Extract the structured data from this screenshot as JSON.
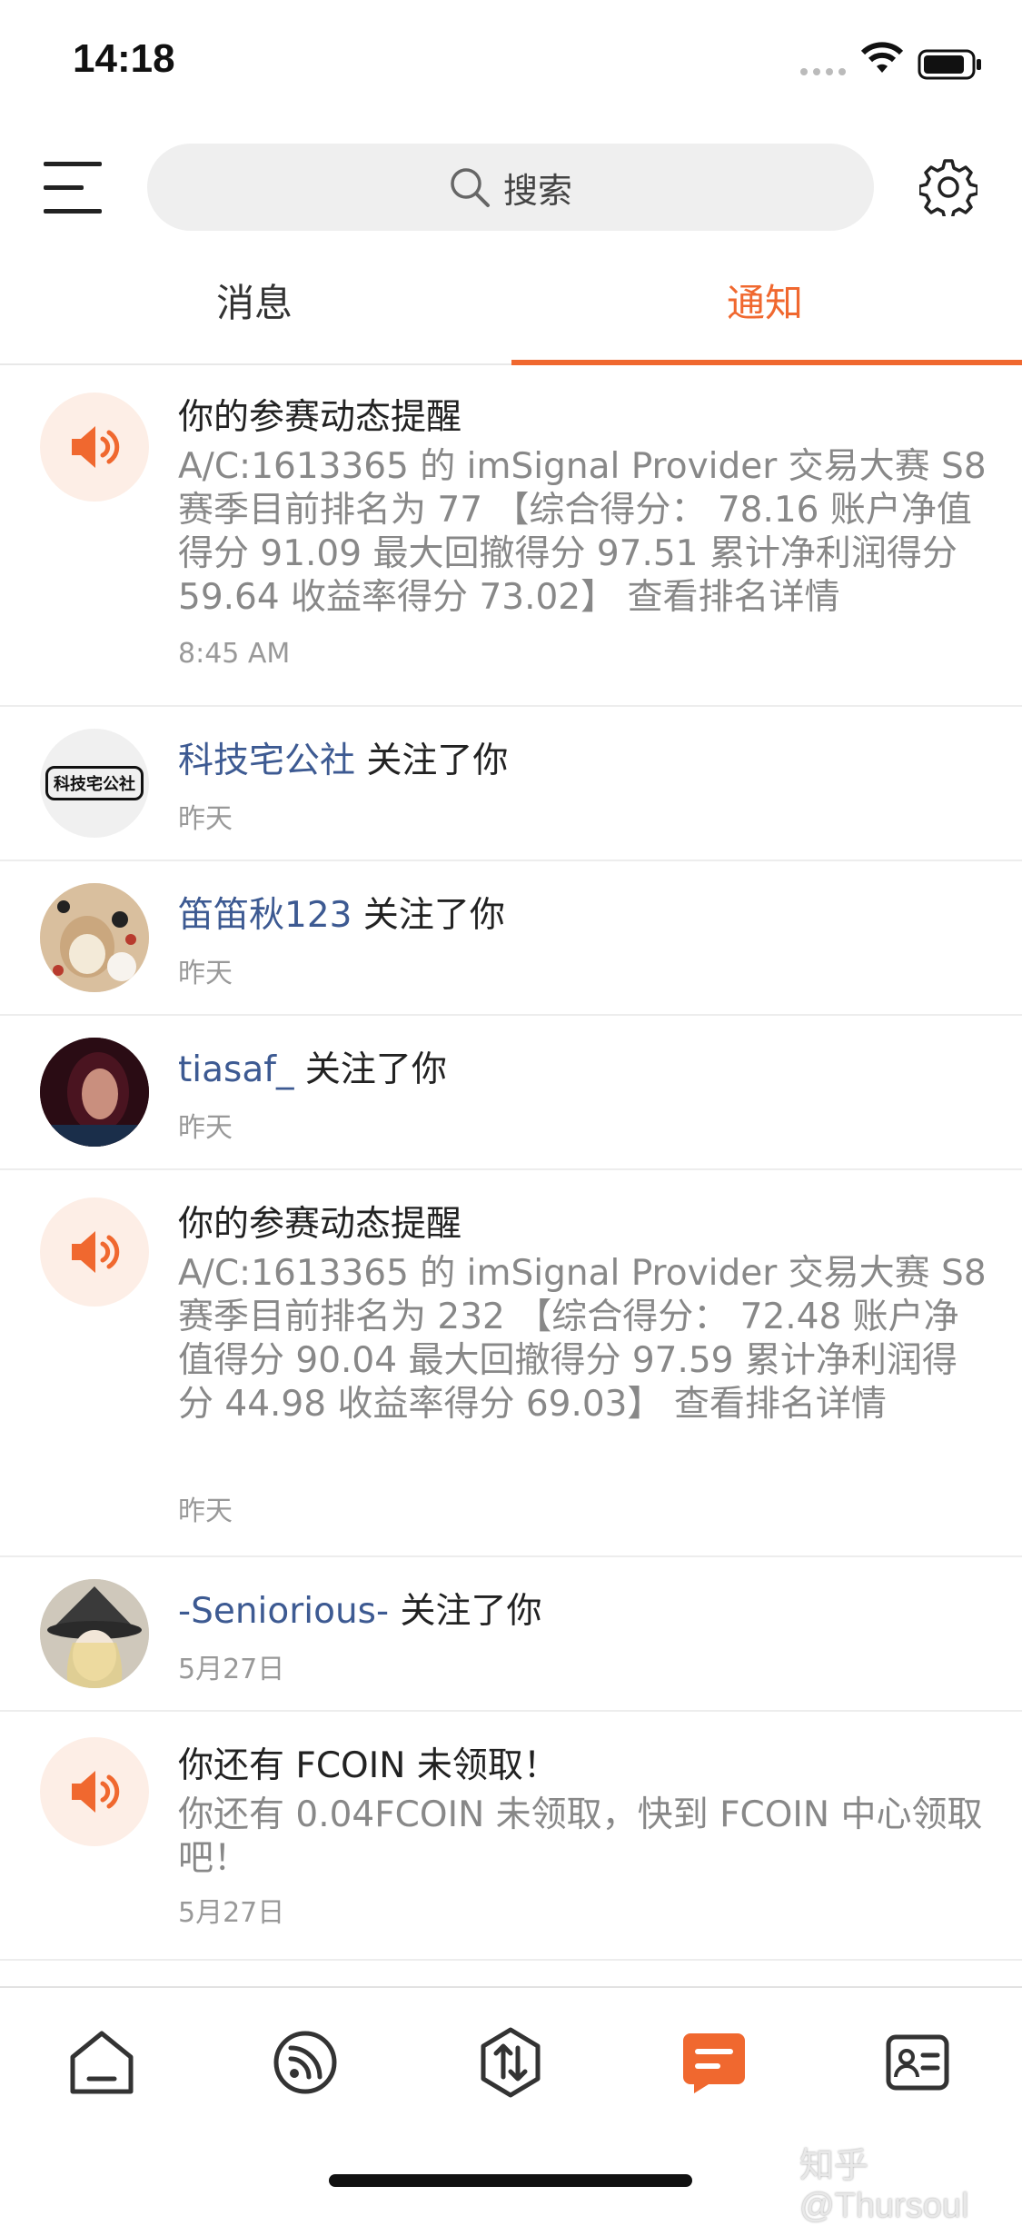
{
  "status_bar": {
    "time": "14:18"
  },
  "header": {
    "search_placeholder": "搜索"
  },
  "tabs": {
    "messages": "消息",
    "notifications": "通知"
  },
  "notifications": [
    {
      "type": "contest",
      "title": "你的参赛动态提醒",
      "body": "A/C:1613365 的 imSignal Provider 交易大赛 S8 赛季目前排名为 77 【综合得分： 78.16 账户净值得分 91.09 最大回撤得分 97.51 累计净利润得分 59.64 收益率得分 73.02】 查看排名详情",
      "time": "8:45 AM"
    },
    {
      "type": "follow",
      "who": "科技宅公社",
      "action": " 关注了你",
      "time": "昨天",
      "avatar_text": "科技宅公社"
    },
    {
      "type": "follow",
      "who": "笛笛秋123",
      "action": " 关注了你",
      "time": "昨天"
    },
    {
      "type": "follow",
      "who": "tiasaf_",
      "action": " 关注了你",
      "time": "昨天"
    },
    {
      "type": "contest",
      "title": "你的参赛动态提醒",
      "body": "A/C:1613365 的 imSignal Provider 交易大赛 S8 赛季目前排名为 232 【综合得分： 72.48 账户净值得分 90.04 最大回撤得分 97.59 累计净利润得分 44.98 收益率得分 69.03】 查看排名详情",
      "time": "昨天"
    },
    {
      "type": "follow",
      "who": "-Seniorious-",
      "action": " 关注了你",
      "time": "5月27日"
    },
    {
      "type": "reward",
      "title": "你还有 FCOIN 未领取！",
      "body": "你还有 0.04FCOIN 未领取，快到 FCOIN 中心领取吧！",
      "time": "5月27日"
    }
  ],
  "bottom_nav": [
    "home-icon",
    "feed-icon",
    "trade-icon",
    "messages-icon",
    "profile-card-icon"
  ],
  "colors": {
    "accent": "#f0682f",
    "link": "#3d5a92",
    "muted": "#888888"
  },
  "watermark": "知乎 @Thursoul"
}
